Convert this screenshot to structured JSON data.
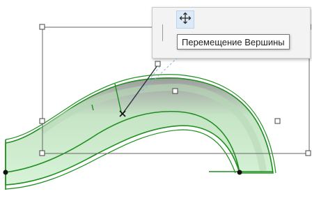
{
  "tooltip": {
    "text": "Перемещение Вершины"
  },
  "palette": {
    "active_command": "move-vertex",
    "icons": [
      "move-arrows-icon"
    ]
  },
  "colors": {
    "wall_fill": "#cfeecf",
    "wall_outline": "#1f8f1f",
    "selection_frame": "#555555",
    "accent_highlight": "#dceaf7"
  }
}
